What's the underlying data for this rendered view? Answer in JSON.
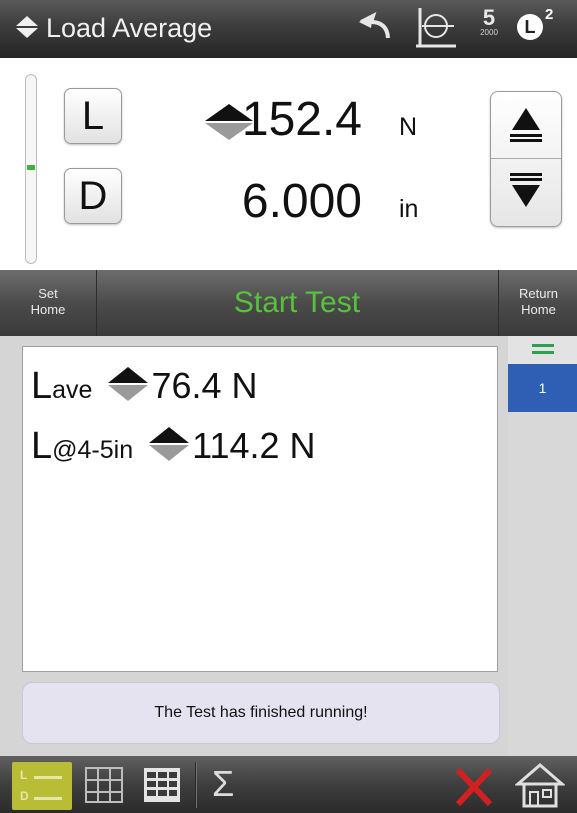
{
  "header": {
    "title": "Load Average",
    "rate_value": "5",
    "rate_sub": "2000",
    "units_letter": "L",
    "units_superscript": "2"
  },
  "readout": {
    "load_button": "L",
    "disp_button": "D",
    "load_value": "152.4",
    "load_unit": "N",
    "disp_value": "6.000",
    "disp_unit": "in"
  },
  "command_bar": {
    "set_home_line1": "Set",
    "set_home_line2": "Home",
    "start_test": "Start Test",
    "return_home_line1": "Return",
    "return_home_line2": "Home"
  },
  "results": [
    {
      "label": "L",
      "sub": "ave",
      "value": "76.4 N"
    },
    {
      "label": "L",
      "sub": "@4-5in",
      "value": "114.2 N"
    }
  ],
  "status_message": "The Test has finished running!",
  "result_list": {
    "items": [
      "1"
    ]
  },
  "colors": {
    "start_test_green": "#57c23c",
    "selected_blue": "#2e5fb5",
    "delete_red": "#d02020",
    "active_tab": "#b9bd36"
  },
  "icons": [
    "sort-arrows-icon",
    "undo-icon",
    "zero-icon",
    "rate-icon",
    "units-icon",
    "jog-up-icon",
    "jog-down-icon",
    "list-menu-icon",
    "load-disp-view-icon",
    "graph-icon",
    "table-icon",
    "sigma-icon",
    "delete-icon",
    "home-icon"
  ]
}
